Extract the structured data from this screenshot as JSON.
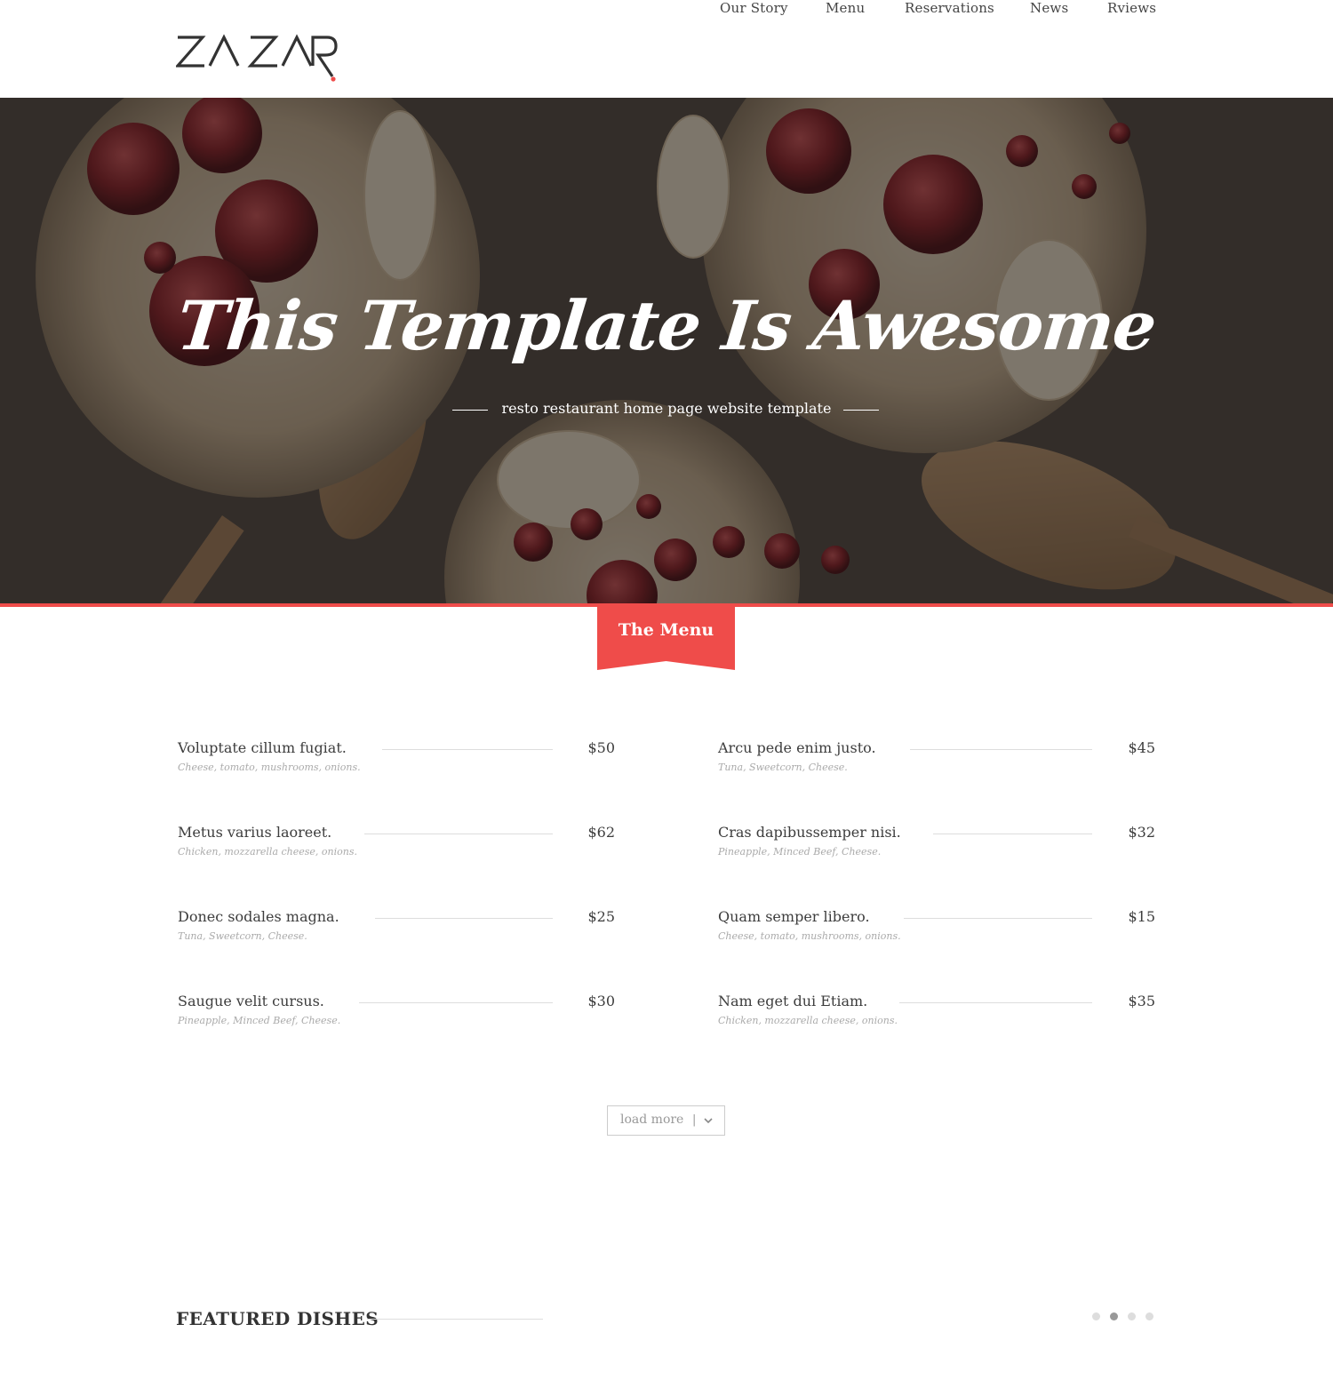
{
  "header": {
    "logo_text": "ZA ZAR",
    "nav": [
      "Our Story",
      "Menu",
      "Reservations",
      "News",
      "Rviews"
    ]
  },
  "hero": {
    "title": "This Template Is Awesome",
    "subtitle": "resto restaurant home page website template"
  },
  "menu_section": {
    "title": "The Menu",
    "items": [
      {
        "name": "Voluptate cillum fugiat.",
        "desc": "Cheese, tomato, mushrooms, onions.",
        "price": "$50"
      },
      {
        "name": "Arcu pede enim justo.",
        "desc": "Tuna, Sweetcorn, Cheese.",
        "price": "$45"
      },
      {
        "name": "Metus varius laoreet.",
        "desc": "Chicken, mozzarella cheese, onions.",
        "price": "$62"
      },
      {
        "name": "Cras dapibussemper nisi.",
        "desc": "Pineapple, Minced Beef, Cheese.",
        "price": "$32"
      },
      {
        "name": "Donec sodales magna.",
        "desc": "Tuna, Sweetcorn, Cheese.",
        "price": "$25"
      },
      {
        "name": "Quam semper libero.",
        "desc": "Cheese, tomato, mushrooms, onions.",
        "price": "$15"
      },
      {
        "name": "Saugue velit cursus.",
        "desc": "Pineapple, Minced Beef, Cheese.",
        "price": "$30"
      },
      {
        "name": "Nam eget dui Etiam.",
        "desc": "Chicken, mozzarella cheese, onions.",
        "price": "$35"
      }
    ],
    "load_more": "load more",
    "separator": "|"
  },
  "featured": {
    "title": "FEATURED DISHES",
    "active_slide": 2,
    "slide_count": 4
  },
  "colors": {
    "accent": "#ef4c4a",
    "text": "#3d3d3d",
    "muted": "#aaaaaa"
  }
}
